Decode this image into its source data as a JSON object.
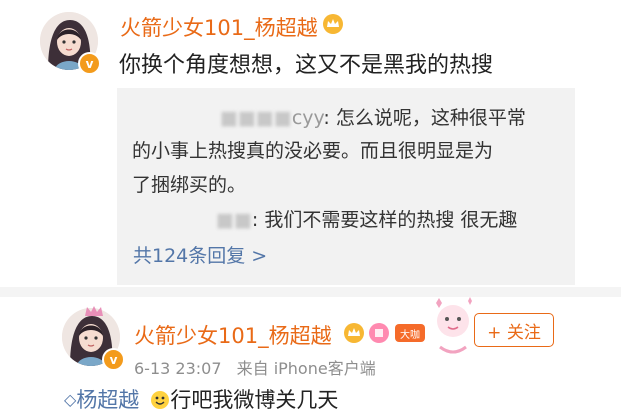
{
  "post": {
    "username": "火箭少女101_杨超越",
    "verified_mark": "v",
    "text": "你换个角度想想，这又不是黑我的热搜"
  },
  "replies": {
    "first_user_suffix": "cyy",
    "first_text_l1": ": 怎么说呢，这种很平常",
    "first_text_l2": "的小事上热搜真的没必要。而且很明显是为",
    "first_text_l3": "了捆绑买的。",
    "second_text": ": 我们不需要这样的热搜 很无趣",
    "more_link": "共124条回复 >"
  },
  "comment": {
    "username": "火箭少女101_杨超越",
    "badge_label": "大咖",
    "verified_mark": "v",
    "time": "6-13 23:07",
    "source": "来自 iPhone客户端",
    "follow_label": "+ 关注",
    "mention": "杨超越",
    "text": "行吧我微博关几天"
  },
  "colors": {
    "username": "#e96a17",
    "link": "#5376a8",
    "verified": "#f39b1c"
  },
  "icons": [
    "avatar-illustration",
    "vip-crown-icon",
    "verified-v-icon",
    "fan-badge-icon",
    "emoji-icon"
  ]
}
